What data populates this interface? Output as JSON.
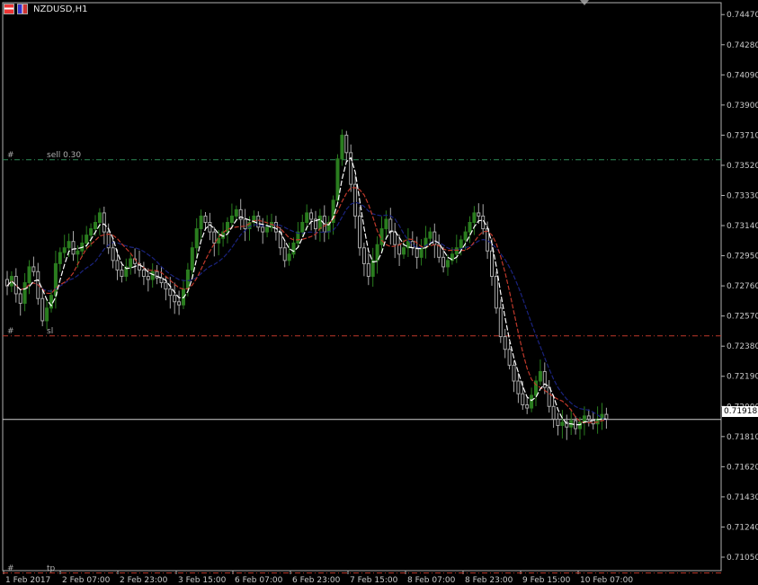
{
  "chart": {
    "title": "NZDUSD,H1",
    "symbol_icons": [
      "chart-window-icon",
      "nzdusd-flag-icon"
    ]
  },
  "price_axis": {
    "labels": [
      "0.74470",
      "0.74280",
      "0.74090",
      "0.73900",
      "0.73710",
      "0.73520",
      "0.73330",
      "0.73140",
      "0.72950",
      "0.72760",
      "0.72570",
      "0.72380",
      "0.72190",
      "0.72000",
      "0.71810",
      "0.71620",
      "0.71430",
      "0.71240",
      "0.71050"
    ],
    "current_price": "0.71918"
  },
  "time_axis": {
    "labels": [
      "1 Feb 2017",
      "2 Feb 07:00",
      "2 Feb 23:00",
      "3 Feb 15:00",
      "6 Feb 07:00",
      "6 Feb 23:00",
      "7 Feb 15:00",
      "8 Feb 07:00",
      "8 Feb 23:00",
      "9 Feb 15:00",
      "10 Feb 07:00"
    ]
  },
  "trade_levels": [
    {
      "id": "sell",
      "hash": "#",
      "label": "sell 0.30",
      "price": 0.73555,
      "color": "#2e8b57"
    },
    {
      "id": "sl",
      "hash": "#",
      "label": "sl",
      "price": 0.72445,
      "color": "#c0392b"
    },
    {
      "id": "tp",
      "hash": "#",
      "label": "tp",
      "price": 0.7095,
      "color": "#c0392b"
    }
  ],
  "colors": {
    "background": "#000000",
    "axis": "#c8c8c8",
    "bull_candle": "#2a7d1f",
    "bear_candle": "#a8a8a8",
    "ma_fast": "#ffffff",
    "ma_mid": "#c0392b",
    "ma_slow": "#1a237e"
  },
  "chart_data": {
    "type": "candlestick",
    "symbol": "NZDUSD",
    "timeframe": "H1",
    "ylim": [
      0.7095,
      0.7457
    ],
    "close_series": [
      0.7276,
      0.7282,
      0.7271,
      0.7265,
      0.7278,
      0.7288,
      0.7285,
      0.7268,
      0.7254,
      0.7262,
      0.727,
      0.729,
      0.7297,
      0.73,
      0.7304,
      0.7296,
      0.7298,
      0.7303,
      0.7308,
      0.7312,
      0.7316,
      0.7322,
      0.731,
      0.73,
      0.7292,
      0.7286,
      0.7282,
      0.7288,
      0.7293,
      0.729,
      0.7286,
      0.7282,
      0.728,
      0.7285,
      0.7281,
      0.7278,
      0.7274,
      0.727,
      0.7266,
      0.7264,
      0.7274,
      0.7286,
      0.73,
      0.7312,
      0.732,
      0.7316,
      0.731,
      0.7303,
      0.7306,
      0.731,
      0.7316,
      0.732,
      0.7324,
      0.7318,
      0.7312,
      0.7316,
      0.732,
      0.7313,
      0.731,
      0.7313,
      0.7316,
      0.731,
      0.73,
      0.7292,
      0.7296,
      0.7303,
      0.731,
      0.7316,
      0.7322,
      0.7318,
      0.7312,
      0.732,
      0.731,
      0.7316,
      0.733,
      0.7356,
      0.7371,
      0.736,
      0.734,
      0.732,
      0.73,
      0.729,
      0.7282,
      0.7292,
      0.7302,
      0.7312,
      0.7318,
      0.731,
      0.7302,
      0.7296,
      0.73,
      0.7304,
      0.73,
      0.7294,
      0.73,
      0.7306,
      0.731,
      0.7302,
      0.7294,
      0.7288,
      0.7292,
      0.7296,
      0.73,
      0.7305,
      0.731,
      0.7316,
      0.7322,
      0.732,
      0.7312,
      0.7298,
      0.7282,
      0.7262,
      0.7244,
      0.7236,
      0.7226,
      0.7216,
      0.7208,
      0.7201,
      0.7199,
      0.7207,
      0.7216,
      0.7222,
      0.7212,
      0.72,
      0.7192,
      0.7188,
      0.719,
      0.7187,
      0.7191,
      0.7186,
      0.719,
      0.7194,
      0.7192,
      0.7189,
      0.7192,
      0.7195,
      0.7192
    ]
  }
}
